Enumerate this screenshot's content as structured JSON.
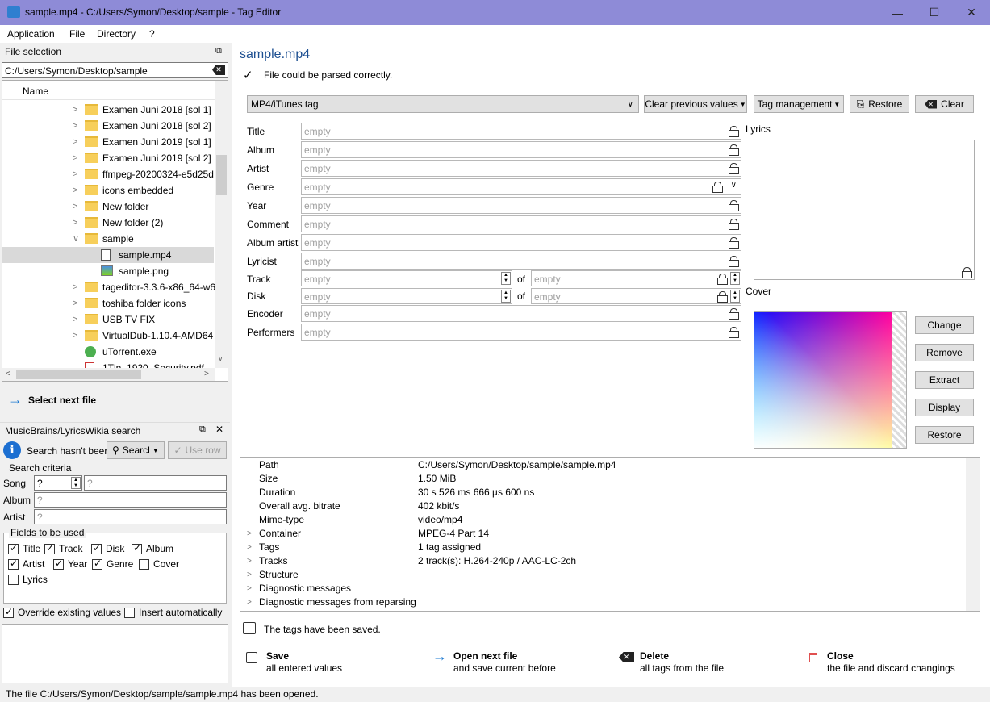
{
  "window": {
    "title": "sample.mp4 - C:/Users/Symon/Desktop/sample - Tag Editor",
    "minimize": "—",
    "maximize": "☐",
    "close": "✕"
  },
  "menu": [
    "Application",
    "File",
    "Directory",
    "?"
  ],
  "file_selection": {
    "header": "File selection",
    "path": "C:/Users/Symon/Desktop/sample",
    "column": "Name",
    "items": [
      {
        "label": "Examen Juni 2018 [sol 1]",
        "type": "folder"
      },
      {
        "label": "Examen Juni 2018 [sol 2]",
        "type": "folder"
      },
      {
        "label": "Examen Juni 2019 [sol 1]",
        "type": "folder"
      },
      {
        "label": "Examen Juni 2019 [sol 2]",
        "type": "folder"
      },
      {
        "label": "ffmpeg-20200324-e5d25d",
        "type": "folder"
      },
      {
        "label": "icons embedded",
        "type": "folder"
      },
      {
        "label": "New folder",
        "type": "folder"
      },
      {
        "label": "New folder (2)",
        "type": "folder"
      },
      {
        "label": "sample",
        "type": "folder-open"
      },
      {
        "label": "sample.mp4",
        "type": "file-selected"
      },
      {
        "label": "sample.png",
        "type": "image"
      },
      {
        "label": "tageditor-3.3.6-x86_64-w6",
        "type": "folder"
      },
      {
        "label": "toshiba folder icons",
        "type": "folder"
      },
      {
        "label": "USB TV FIX",
        "type": "folder"
      },
      {
        "label": "VirtualDub-1.10.4-AMD64",
        "type": "folder"
      },
      {
        "label": "uTorrent.exe",
        "type": "exe"
      },
      {
        "label": "1Tln_1920_Security.pdf",
        "type": "pdf"
      }
    ],
    "select_next": "Select next file"
  },
  "search": {
    "header": "MusicBrains/LyricsWikia search",
    "status": "Search hasn't beer",
    "search_btn": "Searcl",
    "use_row_btn": "Use row",
    "criteria_label": "Search criteria",
    "song_label": "Song",
    "song_num": "?",
    "song_placeholder": "?",
    "album_label": "Album",
    "album_placeholder": "?",
    "artist_label": "Artist",
    "artist_placeholder": "?",
    "fields_label": "Fields to be used",
    "fields": [
      {
        "label": "Title",
        "checked": true
      },
      {
        "label": "Track",
        "checked": true
      },
      {
        "label": "Disk",
        "checked": true
      },
      {
        "label": "Album",
        "checked": true
      },
      {
        "label": "Artist",
        "checked": true
      },
      {
        "label": "Year",
        "checked": true
      },
      {
        "label": "Genre",
        "checked": true
      },
      {
        "label": "Cover",
        "checked": false
      },
      {
        "label": "Lyrics",
        "checked": false
      }
    ],
    "override": "Override existing values",
    "insert_auto": "Insert automatically"
  },
  "status_bar": "The file C:/Users/Symon/Desktop/sample/sample.mp4 has been opened.",
  "main": {
    "file_name": "sample.mp4",
    "parse_status": "File could be parsed correctly.",
    "tag_select": "MP4/iTunes tag",
    "clear_prev": "Clear previous values",
    "tag_mgmt": "Tag management",
    "restore": "Restore",
    "clear": "Clear",
    "fields": [
      {
        "label": "Title",
        "placeholder": "empty"
      },
      {
        "label": "Album",
        "placeholder": "empty"
      },
      {
        "label": "Artist",
        "placeholder": "empty"
      },
      {
        "label": "Genre",
        "placeholder": "empty"
      },
      {
        "label": "Year",
        "placeholder": "empty"
      },
      {
        "label": "Comment",
        "placeholder": "empty"
      },
      {
        "label": "Album artist",
        "placeholder": "empty"
      },
      {
        "label": "Lyricist",
        "placeholder": "empty"
      }
    ],
    "track_label": "Track",
    "disk_label": "Disk",
    "of": "of",
    "empty": "empty",
    "encoder_label": "Encoder",
    "performers_label": "Performers",
    "lyrics_label": "Lyrics",
    "cover_label": "Cover",
    "cover_buttons": [
      "Change",
      "Remove",
      "Extract",
      "Display",
      "Restore"
    ]
  },
  "info": [
    {
      "key": "Path",
      "value": "C:/Users/Symon/Desktop/sample/sample.mp4",
      "expandable": false
    },
    {
      "key": "Size",
      "value": "1.50 MiB",
      "expandable": false
    },
    {
      "key": "Duration",
      "value": "30 s 526 ms 666 µs 600 ns",
      "expandable": false
    },
    {
      "key": "Overall avg. bitrate",
      "value": "402 kbit/s",
      "expandable": false
    },
    {
      "key": "Mime-type",
      "value": "video/mp4",
      "expandable": false
    },
    {
      "key": "Container",
      "value": "MPEG-4 Part 14",
      "expandable": true
    },
    {
      "key": "Tags",
      "value": "1 tag assigned",
      "expandable": true
    },
    {
      "key": "Tracks",
      "value": "2 track(s): H.264-240p / AAC-LC-2ch",
      "expandable": true
    },
    {
      "key": "Structure",
      "value": "",
      "expandable": true
    },
    {
      "key": "Diagnostic messages",
      "value": "",
      "expandable": true
    },
    {
      "key": "Diagnostic messages from reparsing",
      "value": "",
      "expandable": true
    }
  ],
  "saved_msg": "The tags have been saved.",
  "actions": [
    {
      "title": "Save",
      "sub": "all entered values"
    },
    {
      "title": "Open next file",
      "sub": "and save current before"
    },
    {
      "title": "Delete",
      "sub": "all tags from the file"
    },
    {
      "title": "Close",
      "sub": "the file and discard changings"
    }
  ]
}
